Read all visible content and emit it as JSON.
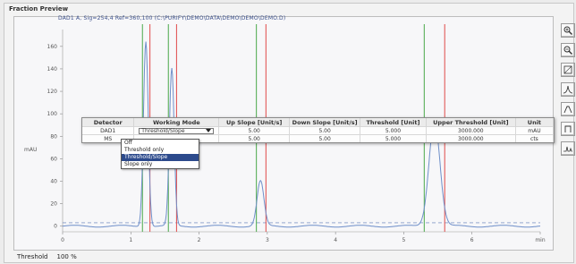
{
  "panel_title": "Fraction Preview",
  "signal_title": "DAD1 A, Sig=254,4 Ref=360,100 (C:\\PURIFY\\DEMO\\DATA\\DEMO\\DEMO\\DEMO.D)",
  "y_unit": "mAU",
  "x_unit": "min",
  "threshold_label": "Threshold",
  "threshold_value": "100 %",
  "colors": {
    "signal": "#6f8fc9",
    "peak_start": "#49a849",
    "peak_end": "#e04a4a",
    "threshold_line": "#5a78b8",
    "selection": "#2c4a8c"
  },
  "grid": {
    "headers": [
      "Detector",
      "Working Mode",
      "Up Slope [Unit/s]",
      "Down Slope [Unit/s]",
      "Threshold [Unit]",
      "Upper Threshold [Unit]",
      "Unit"
    ],
    "rows": [
      [
        "DAD1",
        "Threshold/Slope",
        "5.00",
        "5.00",
        "5.000",
        "3000.000",
        "mAU"
      ],
      [
        "MS",
        "",
        "5.00",
        "5.00",
        "5.000",
        "3000.000",
        "cts"
      ]
    ]
  },
  "dropdown_options": [
    "Off",
    "Threshold only",
    "Threshold/Slope",
    "Slope only"
  ],
  "selected_option": "Threshold/Slope",
  "toolbar": [
    "zoom-in-icon",
    "zoom-out-icon",
    "autoscale-icon",
    "peak-icon",
    "slope-icon",
    "fraction-icon",
    "signal-icon"
  ],
  "chart_data": {
    "type": "line",
    "xlabel": "min",
    "ylabel": "mAU",
    "x_ticks": [
      "0",
      "1",
      "2",
      "3",
      "4",
      "5",
      "6",
      "min"
    ],
    "y_ticks": [
      "0",
      "20",
      "40",
      "60",
      "80",
      "100",
      "120",
      "140",
      "160"
    ],
    "xlim": [
      0,
      7
    ],
    "ylim": [
      -5,
      175
    ],
    "threshold": 3,
    "peaks": [
      {
        "center": 1.22,
        "height": 165,
        "width": 0.035
      },
      {
        "center": 1.6,
        "height": 140,
        "width": 0.035
      },
      {
        "center": 2.9,
        "height": 40,
        "width": 0.05
      },
      {
        "center": 5.45,
        "height": 95,
        "width": 0.08
      }
    ],
    "fraction_markers": [
      {
        "start": 1.17,
        "end": 1.28
      },
      {
        "start": 1.55,
        "end": 1.67
      },
      {
        "start": 2.84,
        "end": 2.98
      },
      {
        "start": 5.3,
        "end": 5.6
      }
    ]
  }
}
